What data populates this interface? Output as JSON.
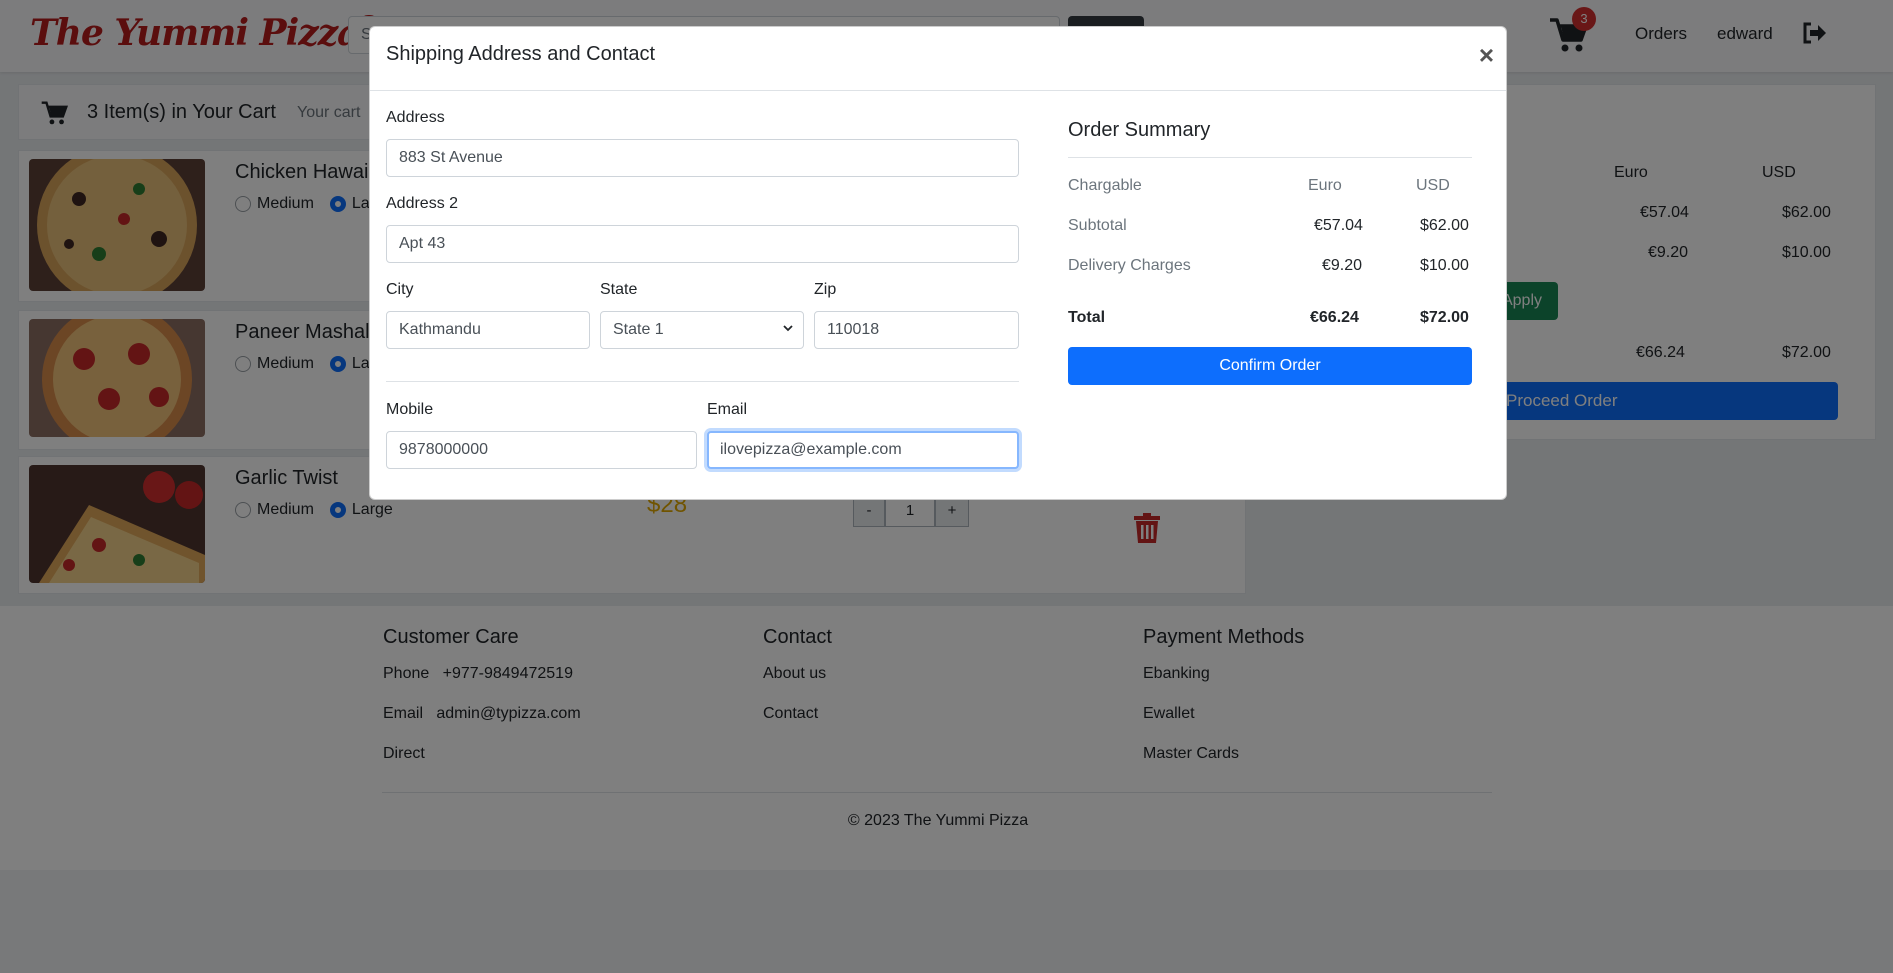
{
  "header": {
    "logo": "The Yummi Pizza",
    "logo_tm": "TM",
    "search_placeholder": "S",
    "cart_count": "3",
    "orders_label": "Orders",
    "user_label": "edward"
  },
  "cart": {
    "title": "3 Item(s) in Your Cart",
    "subtitle": "Your cart",
    "items": [
      {
        "name": "Chicken Hawaii",
        "size_medium": "Medium",
        "size_large": "La",
        "selected": "large"
      },
      {
        "name": "Paneer Mashala",
        "size_medium": "Medium",
        "size_large": "La",
        "selected": "large"
      },
      {
        "name": "Garlic Twist",
        "size_medium": "Medium",
        "size_large": "Large",
        "selected": "large",
        "price": "$28",
        "qty_minus": "-",
        "qty": "1",
        "qty_plus": "+"
      }
    ]
  },
  "background_summary": {
    "col_euro": "Euro",
    "col_usd": "USD",
    "row1_euro": "€57.04",
    "row1_usd": "$62.00",
    "row2_euro": "€9.20",
    "row2_usd": "$10.00",
    "apply_label": "Apply",
    "total_euro": "€66.24",
    "total_usd": "$72.00",
    "proceed_label": "Proceed Order"
  },
  "footer": {
    "customer_care": {
      "heading": "Customer Care",
      "phone_label": "Phone",
      "phone_value": "+977-9849472519",
      "email_label": "Email",
      "email_value": "admin@typizza.com",
      "direct": "Direct"
    },
    "contact": {
      "heading": "Contact",
      "about": "About us",
      "contact": "Contact"
    },
    "payment": {
      "heading": "Payment Methods",
      "ebanking": "Ebanking",
      "ewallet": "Ewallet",
      "master_cards": "Master Cards"
    },
    "copyright": "© 2023 The Yummi Pizza"
  },
  "modal": {
    "title": "Shipping Address and Contact",
    "close": "×",
    "address_label": "Address",
    "address_value": "883 St Avenue",
    "address2_label": "Address 2",
    "address2_value": "Apt 43",
    "city_label": "City",
    "city_value": "Kathmandu",
    "state_label": "State",
    "state_value": "State 1",
    "zip_label": "Zip",
    "zip_value": "110018",
    "mobile_label": "Mobile",
    "mobile_value": "9878000000",
    "email_label": "Email",
    "email_value": "ilovepizza@example.com",
    "order_summary": {
      "title": "Order Summary",
      "header_chargable": "Chargable",
      "header_euro": "Euro",
      "header_usd": "USD",
      "rows": [
        {
          "label": "Subtotal",
          "euro": "€57.04",
          "usd": "$62.00"
        },
        {
          "label": "Delivery Charges",
          "euro": "€9.20",
          "usd": "$10.00"
        }
      ],
      "total_label": "Total",
      "total_euro": "€66.24",
      "total_usd": "$72.00",
      "confirm_label": "Confirm Order"
    }
  },
  "colors": {
    "brand": "#b71c1c",
    "primary": "#0d6efd",
    "success": "#198754",
    "price": "#e0a800",
    "danger": "#c62828"
  }
}
